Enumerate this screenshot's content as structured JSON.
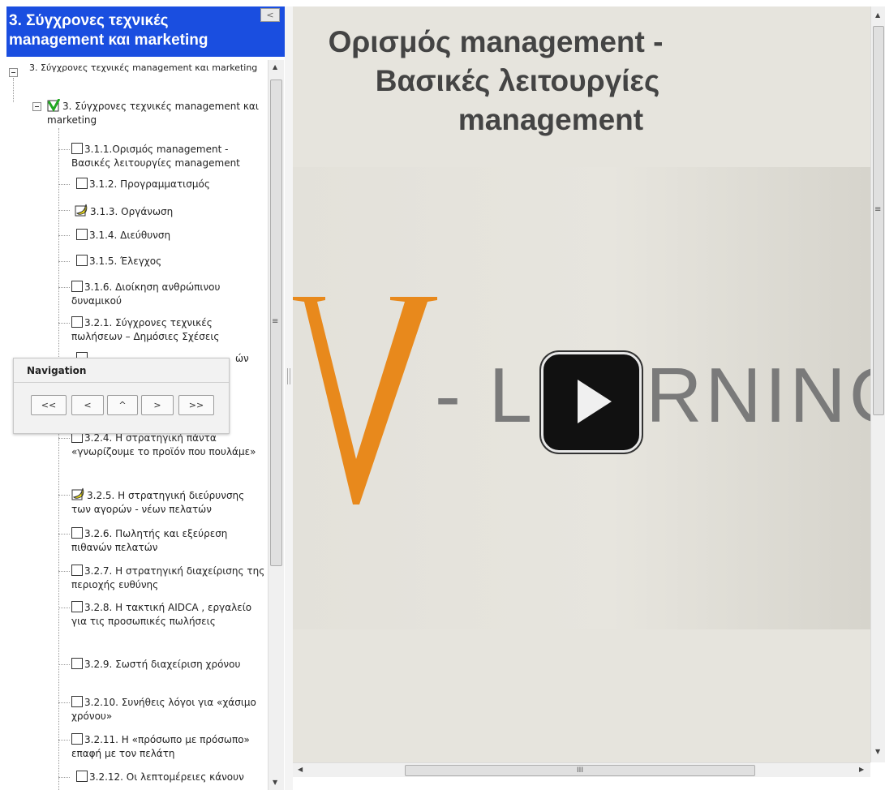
{
  "left": {
    "header_title": "3. Σύγχρονες τεχνικές management και marketing",
    "collapse_icon": "<"
  },
  "tree": {
    "root": "3. Σύγχρονες τεχνικές management και marketing",
    "chapter": "3. Σύγχρονες τεχνικές management και marketing",
    "items": [
      {
        "label": "3.1.1.Ορισμός management - Βασικές λειτουργίες management",
        "status": "unchecked"
      },
      {
        "label": "3.1.2. Προγραμματισμός",
        "status": "unchecked"
      },
      {
        "label": "3.1.3. Οργάνωση",
        "status": "in-progress"
      },
      {
        "label": "3.1.4. Διεύθυνση",
        "status": "unchecked"
      },
      {
        "label": "3.1.5. Έλεγχος",
        "status": "unchecked"
      },
      {
        "label": "3.1.6. Διοίκηση ανθρώπινου δυναμικού",
        "status": "unchecked"
      },
      {
        "label": "3.2.1. Σύγχρονες τεχνικές πωλήσεων – Δημόσιες Σχέσεις",
        "status": "unchecked"
      },
      {
        "label": "3.2.4. Η στρατηγική πάντα «γνωρίζουμε το προϊόν που πουλάμε»",
        "status": "unchecked"
      },
      {
        "label": "3.2.5. Η στρατηγική διεύρυνσης των αγορών - νέων πελατών",
        "status": "in-progress"
      },
      {
        "label": "3.2.6. Πωλητής και εξεύρεση πιθανών πελατών",
        "status": "unchecked"
      },
      {
        "label": "3.2.7. Η στρατηγική διαχείρισης της περιοχής ευθύνης",
        "status": "unchecked"
      },
      {
        "label": "3.2.8. Η τακτική AIDCA , εργαλείο για τις προσωπικές πωλήσεις",
        "status": "unchecked"
      },
      {
        "label": "3.2.9. Σωστή διαχείριση χρόνου",
        "status": "unchecked"
      },
      {
        "label": "3.2.10. Συνήθεις λόγοι για «χάσιμο χρόνου»",
        "status": "unchecked"
      },
      {
        "label": "3.2.11. Η «πρόσωπο με πρόσωπο» επαφή με τον πελάτη",
        "status": "unchecked"
      },
      {
        "label": "3.2.12. Οι λεπτομέρειες κάνουν",
        "status": "unchecked"
      }
    ],
    "partial_hidden": "ών"
  },
  "navigation": {
    "title": "Navigation",
    "first": "<<",
    "prev": "<",
    "up": "^",
    "next": ">",
    "last": ">>"
  },
  "content": {
    "title_line1": "Ορισμός management -",
    "title_line2": "Βασικές λειτουργίες",
    "title_line3": "management",
    "video_logo_letter": "V",
    "video_logo_text": "- LEARNING"
  },
  "scrollbars": {
    "hscroll_grip": "III",
    "tree_grip": "≡",
    "vscroll_grip": "≡"
  },
  "colors": {
    "header_bg": "#1a4ee0",
    "logo_orange": "#e8891c",
    "logo_gray": "#7a7a7a",
    "slide_bg": "#e6e4dd"
  }
}
